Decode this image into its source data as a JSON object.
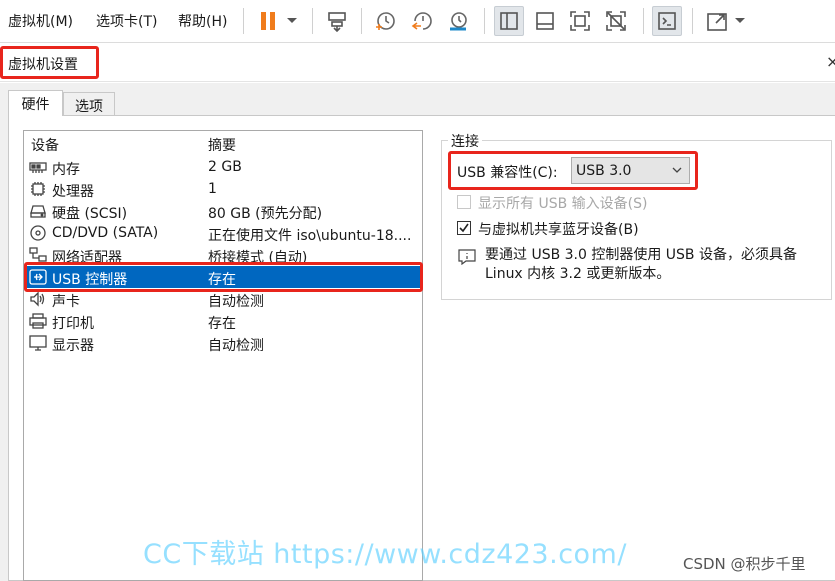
{
  "menubar": {
    "items": [
      "虚拟机(M)",
      "选项卡(T)",
      "帮助(H)"
    ]
  },
  "toolbar": {
    "icons": [
      "pause-icon",
      "dropdown-icon",
      "send-keys-icon",
      "snapshot-icon",
      "revert-snapshot-icon",
      "snapshot-manager-icon",
      "show-sidebar-icon",
      "thumbnail-icon",
      "fullscreen-icon",
      "unity-icon",
      "console-icon",
      "stretch-icon",
      "dropdown-icon"
    ],
    "accent": "#f07c1c"
  },
  "dialog": {
    "title": "虚拟机设置",
    "close": "×",
    "tabs": [
      "硬件",
      "选项"
    ],
    "active_tab": "硬件"
  },
  "devices": {
    "headers": [
      "设备",
      "摘要"
    ],
    "rows": [
      {
        "name": "内存",
        "summary": "2 GB",
        "icon": "memory-icon"
      },
      {
        "name": "处理器",
        "summary": "1",
        "icon": "cpu-icon"
      },
      {
        "name": "硬盘 (SCSI)",
        "summary": "80 GB (预先分配)",
        "icon": "harddisk-icon"
      },
      {
        "name": "CD/DVD (SATA)",
        "summary": "正在使用文件 iso\\ubuntu-18....",
        "icon": "cd-icon"
      },
      {
        "name": "网络适配器",
        "summary": "桥接模式 (自动)",
        "icon": "network-icon"
      },
      {
        "name": "USB 控制器",
        "summary": "存在",
        "icon": "usb-icon"
      },
      {
        "name": "声卡",
        "summary": "自动检测",
        "icon": "sound-icon"
      },
      {
        "name": "打印机",
        "summary": "存在",
        "icon": "printer-icon"
      },
      {
        "name": "显示器",
        "summary": "自动检测",
        "icon": "display-icon"
      }
    ],
    "selected": "USB 控制器",
    "selection_color": "#0067c0"
  },
  "connection": {
    "legend": "连接",
    "compat_label": "USB 兼容性(C):",
    "compat_value": "USB 3.0",
    "show_all_label": "显示所有 USB 输入设备(S)",
    "show_all_checked": false,
    "bluetooth_label": "与虚拟机共享蓝牙设备(B)",
    "bluetooth_checked": true,
    "info_text": "要通过 USB 3.0 控制器使用 USB 设备，必须具备 Linux 内核 3.2 或更新版本。"
  },
  "highlight_color": "#e8251c",
  "watermark": "CC下载站 https://www.cdz423.com/",
  "credit": "CSDN @积步千里"
}
